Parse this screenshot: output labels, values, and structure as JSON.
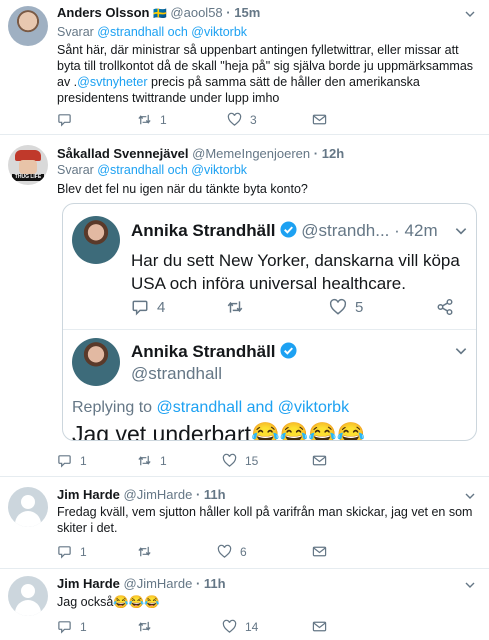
{
  "tweets": [
    {
      "name": "Anders Olsson",
      "flag": "🇸🇪",
      "handle": "@aool58",
      "time": "15m",
      "reply_prefix": "Svarar ",
      "reply_users": "@strandhall och @viktorbk",
      "body_line1": "Sånt här, där ministrar så uppenbart antingen fylletwittrar, eller missar att",
      "body_line2": "byta till trollkontot då de skall \"heja på\" sig själva borde ju uppmärksammas",
      "body_line3_prefix": "av .",
      "body_line3_link": "@svtnyheter",
      "body_line3_suffix": " precis på samma sätt de håller den amerikanska",
      "body_line4": "presidentens twittrande under lupp imho",
      "replies": "",
      "retweets": "1",
      "likes": "3"
    },
    {
      "name": "Såkallad Svennejävel",
      "handle": "@MemeIngenjoeren",
      "time": "12h",
      "avatar_label": "THUG LIFE",
      "reply_prefix": "Svarar ",
      "reply_users": "@strandhall och @viktorbk",
      "body": "Blev det fel nu igen när du tänkte byta konto?",
      "replies": "1",
      "retweets": "1",
      "likes": "15"
    },
    {
      "name": "Jim Harde",
      "handle": "@JimHarde",
      "time": "11h",
      "body_line1": "Fredag kväll, vem sjutton håller koll på varifrån man skickar, jag vet en som",
      "body_line2": "skiter i det.",
      "replies": "1",
      "retweets": "",
      "likes": "6"
    },
    {
      "name": "Jim Harde",
      "handle": "@JimHarde",
      "time": "11h",
      "body": "Jag också😂😂😂",
      "replies": "1",
      "retweets": "",
      "likes": "14"
    }
  ],
  "quote": {
    "first": {
      "name": "Annika Strandhäll",
      "handle": "@strandh...",
      "time": "42m",
      "line1": "Har du sett New Yorker, danskarna vill köpa",
      "line2": "USA och införa universal healthcare.",
      "replies": "4",
      "likes": "5"
    },
    "second": {
      "name": "Annika Strandhäll",
      "handle": "@strandhall",
      "replying_prefix": "Replying to ",
      "replying_users": "@strandhall and @viktorbk",
      "text": "Jag vet underbart😂😂😂😂"
    }
  },
  "separator": "·",
  "colors": {
    "link": "#1da1f2",
    "muted": "#657786",
    "verified": "#1da1f2",
    "divider": "#e6ecf0"
  }
}
